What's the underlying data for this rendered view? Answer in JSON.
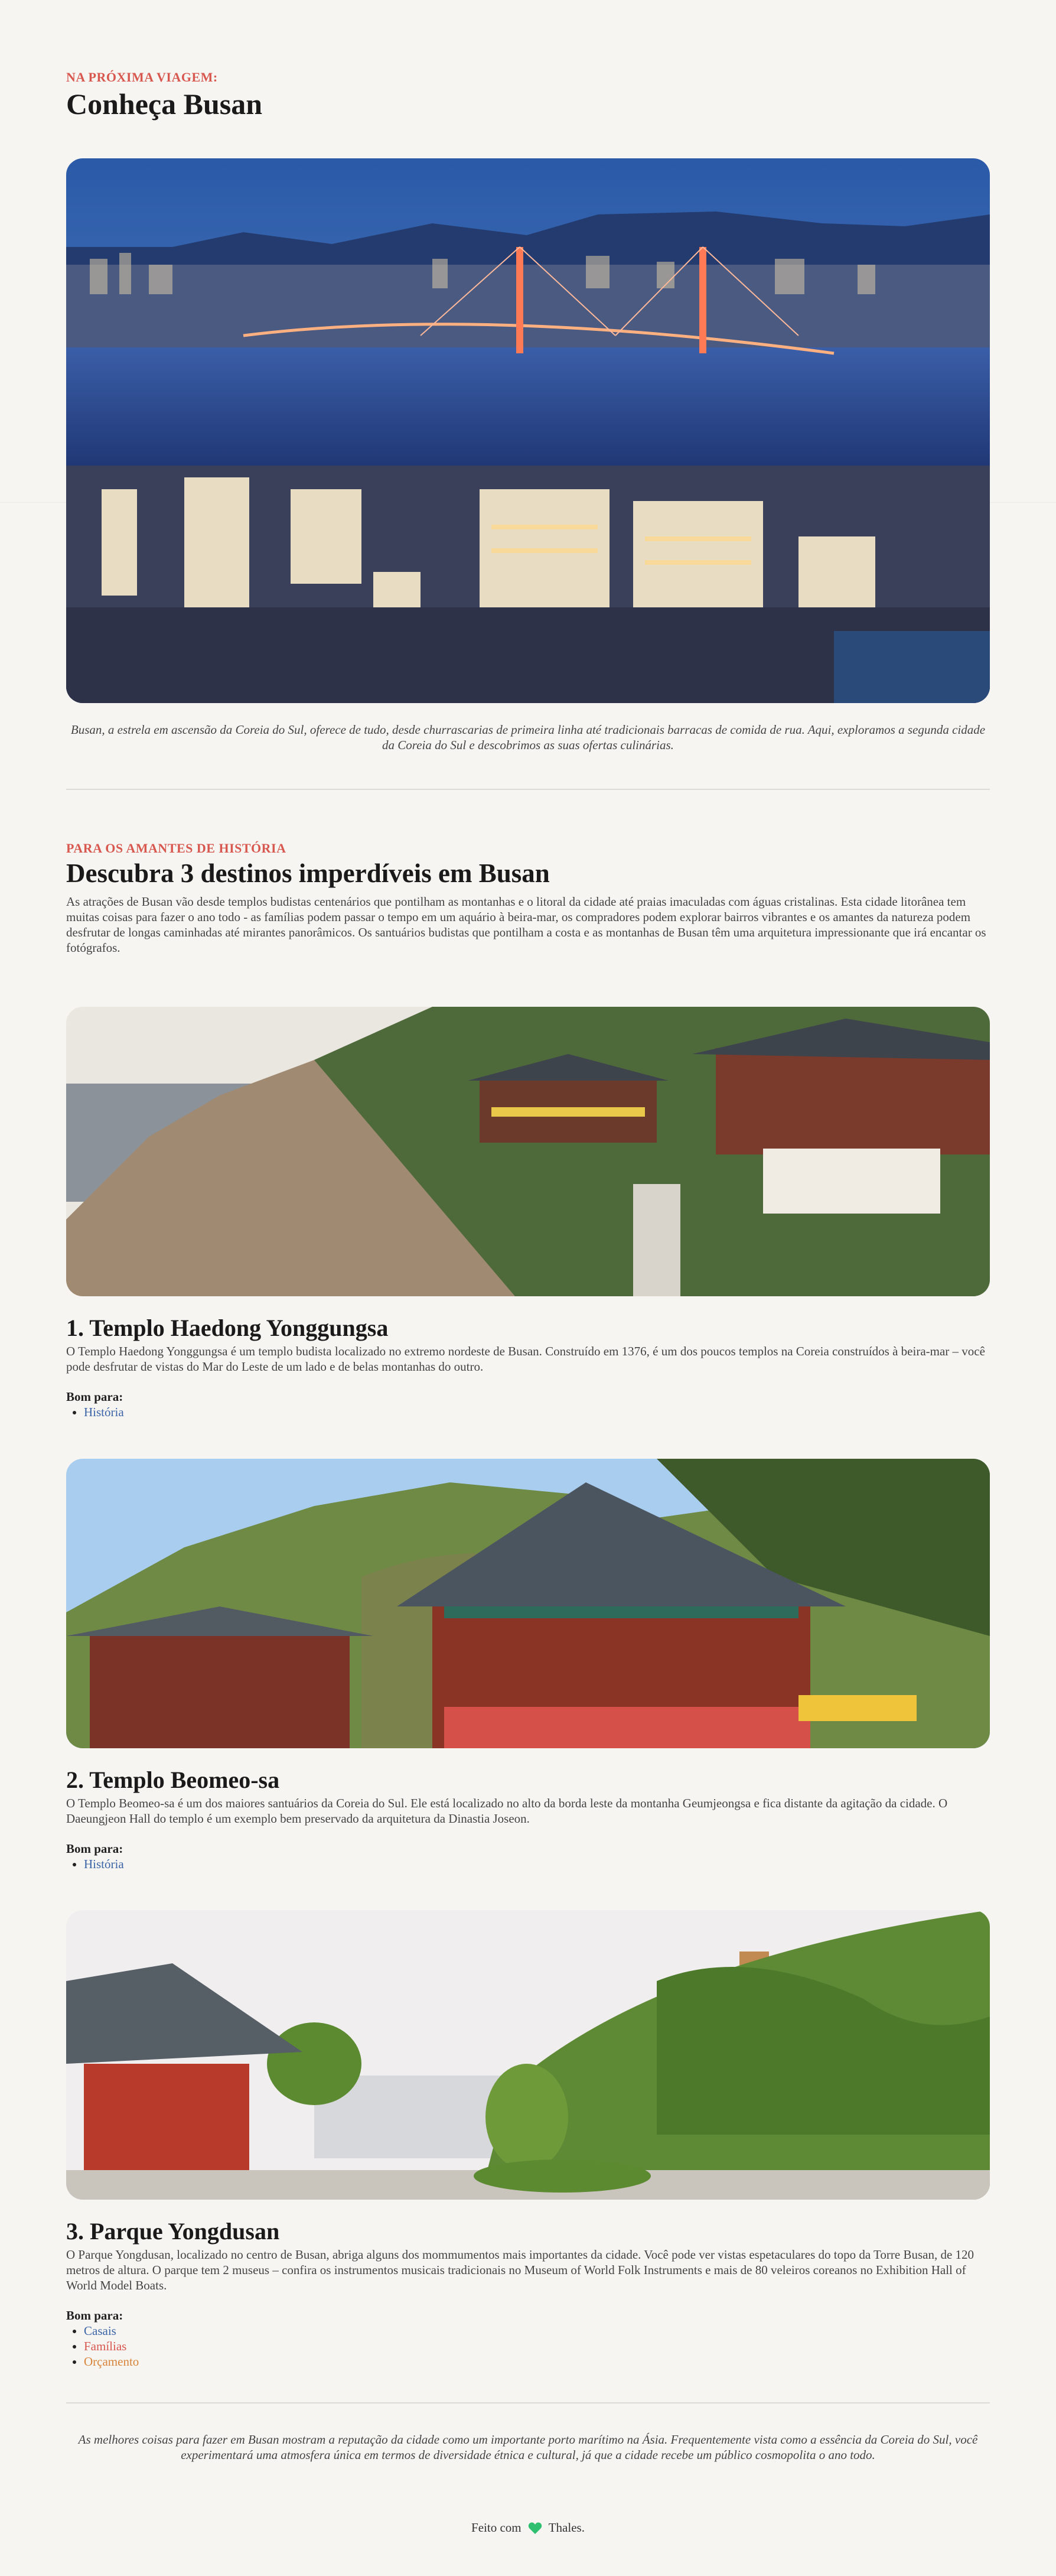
{
  "header": {
    "eyebrow": "NA PRÓXIMA VIAGEM:",
    "title": "Conheça Busan"
  },
  "hero": {
    "image_icon": "busan-harbor-night-photo",
    "caption": "Busan, a estrela em ascensão da Coreia do Sul, oferece de tudo, desde churrascarias de primeira linha até tradicionais barracas de comida de rua. Aqui, exploramos a segunda cidade da Coreia do Sul e descobrimos as suas ofertas culinárias."
  },
  "intro": {
    "eyebrow": "PARA OS AMANTES DE HISTÓRIA",
    "title": "Descubra 3 destinos imperdíveis em Busan",
    "body": "As atrações de Busan vão desde templos budistas centenários que pontilham as montanhas e o litoral da cidade até praias imaculadas com águas cristalinas. Esta cidade litorânea tem muitas coisas para fazer o ano todo - as famílias podem passar o tempo em um aquário à beira-mar, os compradores podem explorar bairros vibrantes e os amantes da natureza podem desfrutar de longas caminhadas até mirantes panorâmicos. Os santuários budistas que pontilham a costa e as montanhas de Busan têm uma arquitetura impressionante que irá encantar os fotógrafos."
  },
  "destinations": [
    {
      "title": "1. Templo Haedong Yonggungsa",
      "body": "O Templo Haedong Yonggungsa é um templo budista localizado no extremo nordeste de Busan. Construído em 1376, é um dos poucos templos na Coreia construídos à beira-mar – você pode desfrutar de vistas do Mar do Leste de um lado e de belas montanhas do outro.",
      "good_for_label": "Bom para:",
      "tags": [
        {
          "label": "História",
          "color": "#3b64a8"
        }
      ]
    },
    {
      "title": "2. Templo Beomeo-sa",
      "body": "O Templo Beomeo-sa é um dos maiores santuários da Coreia do Sul. Ele está localizado no alto da borda leste da montanha Geumjeongsa e fica distante da agitação da cidade. O Daeungjeon Hall do templo é um exemplo bem preservado da arquitetura da Dinastia Joseon.",
      "good_for_label": "Bom para:",
      "tags": [
        {
          "label": "História",
          "color": "#3b64a8"
        }
      ]
    },
    {
      "title": "3. Parque Yongdusan",
      "body": "O Parque Yongdusan, localizado no centro de Busan, abriga alguns dos mommumentos mais importantes da cidade. Você pode ver vistas espetaculares do topo da Torre Busan, de 120 metros de altura. O parque tem 2 museus – confira os instrumentos musicais tradicionais no Museum of World Folk Instruments e mais de 80 veleiros coreanos no Exhibition Hall of World Model Boats.",
      "good_for_label": "Bom para:",
      "tags": [
        {
          "label": "Casais",
          "color": "#3b64a8"
        },
        {
          "label": "Famílias",
          "color": "#d8574f"
        },
        {
          "label": "Orçamento",
          "color": "#d8843a"
        }
      ]
    }
  ],
  "closing": "As melhores coisas para fazer em Busan mostram a reputação da cidade como um importante porto marítimo na Ásia. Frequentemente vista como a essência da Coreia do Sul, você experimentará uma atmosfera única em termos de diversidade étnica e cultural, já que a cidade recebe um público cosmopolita o ano todo.",
  "footer": {
    "made_with": "Feito com",
    "heart_icon": "heart-icon",
    "heart_color": "#2fbf71",
    "author": "Thales."
  }
}
